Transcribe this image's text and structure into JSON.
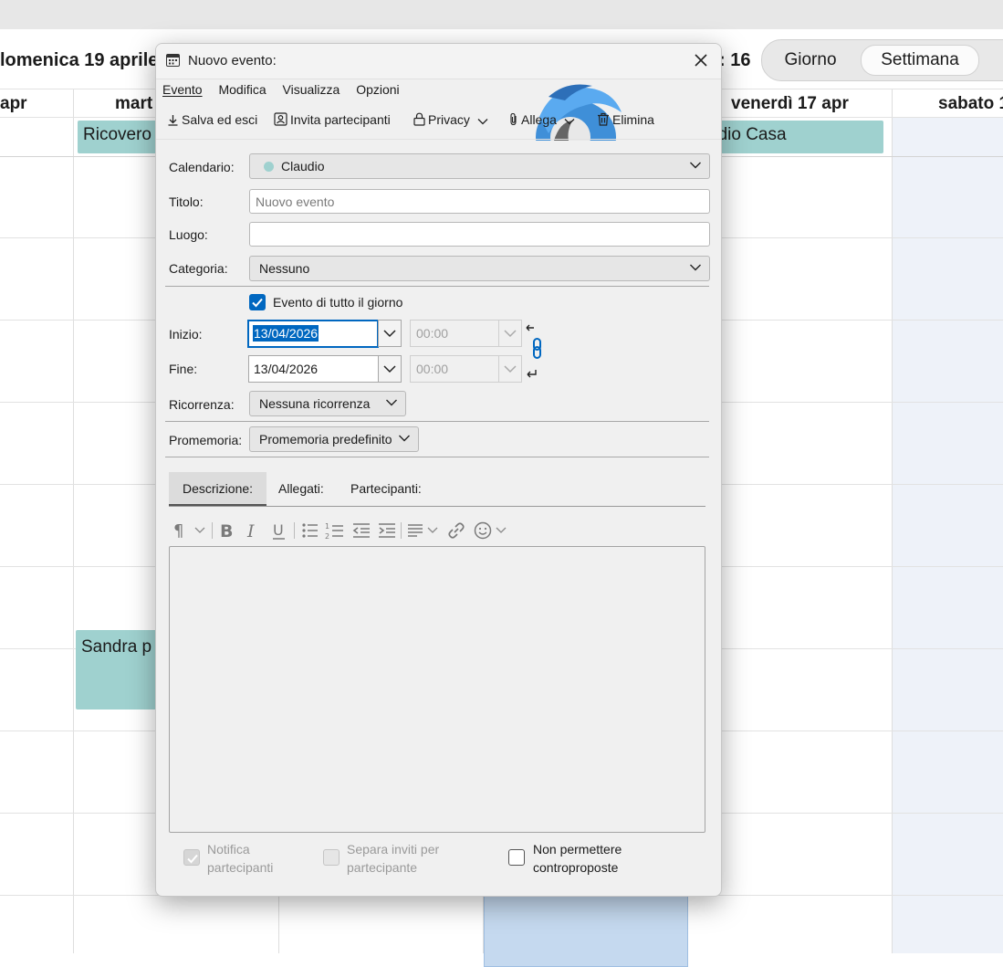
{
  "background": {
    "title_left": "lomenica 19 aprile",
    "title_right": ": 16",
    "view_switch": {
      "day": "Giorno",
      "week": "Settimana"
    },
    "day_headers": [
      "apr",
      "mart",
      "venerdì 17 apr",
      "sabato 1"
    ],
    "events": {
      "ricovero": "Ricovero",
      "claudio_casa": "udio Casa",
      "sandra": "Sandra p"
    }
  },
  "dialog": {
    "title": "Nuovo evento:",
    "menu": [
      "Evento",
      "Modifica",
      "Visualizza",
      "Opzioni"
    ],
    "toolbar": {
      "save": "Salva ed esci",
      "invite": "Invita partecipanti",
      "privacy": "Privacy",
      "attach": "Allega",
      "delete": "Elimina"
    },
    "form": {
      "calendar_label": "Calendario:",
      "calendar_value": "Claudio",
      "calendar_color": "#9fd1cf",
      "title_label": "Titolo:",
      "title_placeholder": "Nuovo evento",
      "location_label": "Luogo:",
      "location_value": "",
      "category_label": "Categoria:",
      "category_value": "Nessuno",
      "allday_label": "Evento di tutto il giorno",
      "allday_checked": true,
      "start_label": "Inizio:",
      "start_date": "13/04/2026",
      "start_time": "00:00",
      "end_label": "Fine:",
      "end_date": "13/04/2026",
      "end_time": "00:00",
      "recurrence_label": "Ricorrenza:",
      "recurrence_value": "Nessuna ricorrenza",
      "reminder_label": "Promemoria:",
      "reminder_value": "Promemoria predefinito"
    },
    "tabs": [
      "Descrizione:",
      "Allegati:",
      "Partecipanti:"
    ],
    "footer": {
      "notify_line1": "Notifica",
      "notify_line2": "partecipanti",
      "separate_line1": "Separa inviti per",
      "separate_line2": "partecipante",
      "nocounter_line1": "Non permettere",
      "nocounter_line2": "controproposte"
    }
  },
  "colors": {
    "accent": "#0067c0",
    "event_teal": "#9fd1cf",
    "weekend_bg": "#eef2f9"
  }
}
